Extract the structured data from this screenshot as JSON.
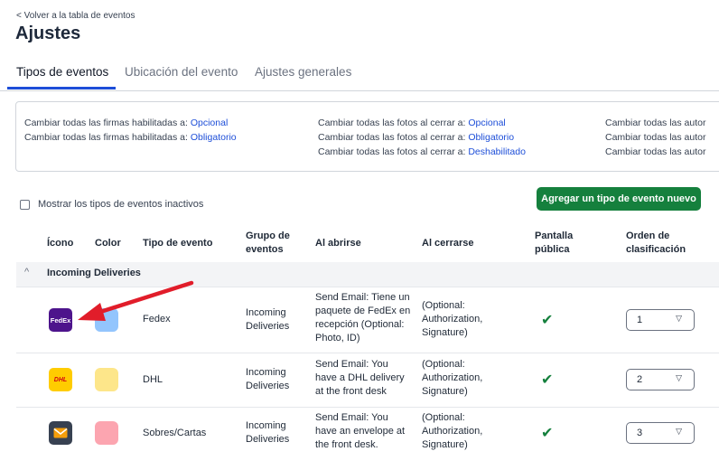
{
  "back_link": "< Volver a la tabla de eventos",
  "title": "Ajustes",
  "tabs": [
    {
      "label": "Tipos de eventos",
      "active": true
    },
    {
      "label": "Ubicación del evento",
      "active": false
    },
    {
      "label": "Ajustes generales",
      "active": false
    }
  ],
  "bulk": {
    "col1": [
      {
        "prefix": "Cambiar todas las firmas habilitadas a: ",
        "link": "Opcional"
      },
      {
        "prefix": "Cambiar todas las firmas habilitadas a: ",
        "link": "Obligatorio"
      }
    ],
    "col2": [
      {
        "prefix": "Cambiar todas las fotos al cerrar a: ",
        "link": "Opcional"
      },
      {
        "prefix": "Cambiar todas las fotos al cerrar a: ",
        "link": "Obligatorio"
      },
      {
        "prefix": "Cambiar todas las fotos al cerrar a: ",
        "link": "Deshabilitado"
      }
    ],
    "col3": [
      "Cambiar todas las autor",
      "Cambiar todas las autor",
      "Cambiar todas las autor"
    ]
  },
  "show_inactive_label": "Mostrar los tipos de eventos inactivos",
  "add_button": "Agregar un tipo de evento nuevo",
  "headers": {
    "icon": "Ícono",
    "color": "Color",
    "type": "Tipo de evento",
    "group": "Grupo de eventos",
    "on_open": "Al abrirse",
    "on_close": "Al cerrarse",
    "public": "Pantalla pública",
    "order": "Orden de clasificación"
  },
  "group_name": "Incoming Deliveries",
  "rows": [
    {
      "icon": "fedex-logo-icon",
      "icon_text": "FedEx",
      "icon_bg": "#4d148c",
      "color": "#93c5fd",
      "type": "Fedex",
      "group": "Incoming Deliveries",
      "on_open": "Send Email: Tiene un paquete de FedEx en recepción (Optional: Photo, ID)",
      "on_close": "(Optional: Authorization, Signature)",
      "order": "1"
    },
    {
      "icon": "dhl-logo-icon",
      "icon_text": "DHL",
      "icon_bg": "#ffcc00",
      "color": "#fde68a",
      "type": "DHL",
      "group": "Incoming Deliveries",
      "on_open": "Send Email: You have a DHL delivery at the front desk",
      "on_close": "(Optional: Authorization, Signature)",
      "order": "2"
    },
    {
      "icon": "envelope-icon",
      "icon_text": "",
      "icon_bg": "#374151",
      "color": "#fca5b0",
      "type": "Sobres/Cartas",
      "group": "Incoming Deliveries",
      "on_open": "Send Email: You have an envelope at the front desk.",
      "on_close": "(Optional: Authorization, Signature)",
      "order": "3"
    }
  ],
  "check_glyph": "✔",
  "colors": {
    "accent": "#1d4ed8",
    "button": "#15803d",
    "arrow": "#e11d2a"
  }
}
